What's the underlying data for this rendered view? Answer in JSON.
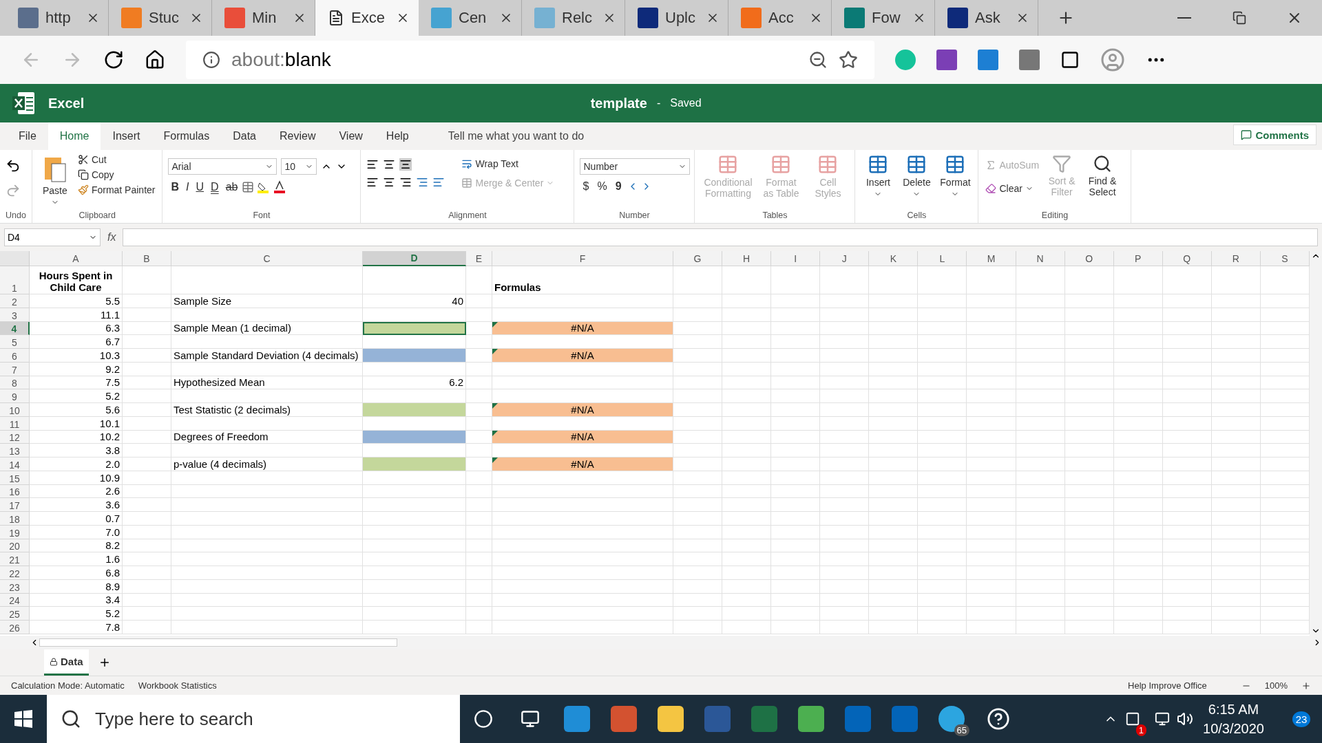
{
  "browser": {
    "tabs": [
      {
        "label": "http",
        "selected": false
      },
      {
        "label": "Stuc",
        "selected": false
      },
      {
        "label": "Min",
        "selected": false
      },
      {
        "label": "Exce",
        "selected": true
      },
      {
        "label": "Cen",
        "selected": false
      },
      {
        "label": "Relc",
        "selected": false
      },
      {
        "label": "Uplc",
        "selected": false
      },
      {
        "label": "Acc",
        "selected": false
      },
      {
        "label": "Fow",
        "selected": false
      },
      {
        "label": "Ask",
        "selected": false
      }
    ],
    "address": {
      "prefix": "about:",
      "value": "blank"
    }
  },
  "excel": {
    "app_name": "Excel",
    "document_title": "template",
    "separator": "-",
    "save_status": "Saved"
  },
  "ribbon": {
    "tabs": [
      {
        "label": "File",
        "selected": false
      },
      {
        "label": "Home",
        "selected": true
      },
      {
        "label": "Insert",
        "selected": false
      },
      {
        "label": "Formulas",
        "selected": false
      },
      {
        "label": "Data",
        "selected": false
      },
      {
        "label": "Review",
        "selected": false
      },
      {
        "label": "View",
        "selected": false
      },
      {
        "label": "Help",
        "selected": false
      }
    ],
    "tell_me": "Tell me what you want to do",
    "comments": "Comments",
    "groups": {
      "undo": {
        "label": "Undo"
      },
      "clipboard": {
        "label": "Clipboard",
        "paste": "Paste",
        "cut": "Cut",
        "copy": "Copy",
        "format_painter": "Format Painter"
      },
      "font": {
        "label": "Font",
        "font_name": "Arial",
        "font_size": "10",
        "bold": "B",
        "italic": "I",
        "underline": "U",
        "double_underline": "D",
        "strikethrough": "ab"
      },
      "alignment": {
        "label": "Alignment",
        "wrap_text": "Wrap Text",
        "merge_center": {
          "label": "Merge & Center",
          "disabled": true
        }
      },
      "number": {
        "label": "Number",
        "format": "Number",
        "currency": "$",
        "percent": "%",
        "comma": "9"
      },
      "tables": {
        "label": "Tables",
        "items": [
          {
            "label": "Conditional Formatting",
            "disabled": true
          },
          {
            "label": "Format as Table",
            "disabled": true
          },
          {
            "label": "Cell Styles",
            "disabled": true
          }
        ]
      },
      "cells": {
        "label": "Cells",
        "items": [
          {
            "label": "Insert",
            "disabled": false
          },
          {
            "label": "Delete",
            "disabled": false
          },
          {
            "label": "Format",
            "disabled": false
          }
        ]
      },
      "editing": {
        "label": "Editing",
        "autosum": {
          "label": "AutoSum",
          "disabled": true
        },
        "clear": {
          "label": "Clear",
          "disabled": false
        },
        "sort_filter": {
          "label": "Sort & Filter",
          "disabled": true
        },
        "find_select": {
          "label": "Find & Select",
          "disabled": false
        }
      }
    }
  },
  "formula_bar": {
    "name_box": "D4",
    "fx": "fx"
  },
  "sheet": {
    "columns": [
      {
        "label": "A",
        "selected": false
      },
      {
        "label": "B",
        "selected": false
      },
      {
        "label": "C",
        "selected": false
      },
      {
        "label": "D",
        "selected": true
      },
      {
        "label": "E",
        "selected": false
      },
      {
        "label": "F",
        "selected": false
      },
      {
        "label": "G",
        "selected": false
      },
      {
        "label": "H",
        "selected": false
      },
      {
        "label": "I",
        "selected": false
      },
      {
        "label": "J",
        "selected": false
      },
      {
        "label": "K",
        "selected": false
      },
      {
        "label": "L",
        "selected": false
      },
      {
        "label": "M",
        "selected": false
      },
      {
        "label": "N",
        "selected": false
      },
      {
        "label": "O",
        "selected": false
      },
      {
        "label": "P",
        "selected": false
      },
      {
        "label": "Q",
        "selected": false
      },
      {
        "label": "R",
        "selected": false
      },
      {
        "label": "S",
        "selected": false
      }
    ],
    "rows": [
      {
        "number": "1",
        "kind": "header",
        "selected": false,
        "a": "Hours Spent in Child Care",
        "f": {
          "text": "Formulas"
        }
      },
      {
        "number": "2",
        "kind": "data",
        "selected": false,
        "a": "5.5",
        "c": "Sample Size",
        "d": {
          "text": "40"
        }
      },
      {
        "number": "3",
        "kind": "data",
        "selected": false,
        "a": "11.1"
      },
      {
        "number": "4",
        "kind": "data",
        "selected": true,
        "a": "6.3",
        "c": "Sample Mean (1 decimal)",
        "d": {
          "color": "#c4d79b",
          "selected": true
        },
        "f": {
          "text": "#N/A",
          "color": "#f8be91",
          "flag": true
        }
      },
      {
        "number": "5",
        "kind": "data",
        "selected": false,
        "a": "6.7"
      },
      {
        "number": "6",
        "kind": "data",
        "selected": false,
        "a": "10.3",
        "c": "Sample Standard Deviation (4 decimals)",
        "d": {
          "color": "#95b3d7",
          "selected": false
        },
        "f": {
          "text": "#N/A",
          "color": "#f8be91",
          "flag": true
        }
      },
      {
        "number": "7",
        "kind": "data",
        "selected": false,
        "a": "9.2"
      },
      {
        "number": "8",
        "kind": "data",
        "selected": false,
        "a": "7.5",
        "c": "Hypothesized Mean",
        "d": {
          "text": "6.2"
        }
      },
      {
        "number": "9",
        "kind": "data",
        "selected": false,
        "a": "5.2"
      },
      {
        "number": "10",
        "kind": "data",
        "selected": false,
        "a": "5.6",
        "c": "Test Statistic (2 decimals)",
        "d": {
          "color": "#c4d79b",
          "selected": false
        },
        "f": {
          "text": "#N/A",
          "color": "#f8be91",
          "flag": true
        }
      },
      {
        "number": "11",
        "kind": "data",
        "selected": false,
        "a": "10.1"
      },
      {
        "number": "12",
        "kind": "data",
        "selected": false,
        "a": "10.2",
        "c": "Degrees of Freedom",
        "d": {
          "color": "#95b3d7",
          "selected": false
        },
        "f": {
          "text": "#N/A",
          "color": "#f8be91",
          "flag": true
        }
      },
      {
        "number": "13",
        "kind": "data",
        "selected": false,
        "a": "3.8"
      },
      {
        "number": "14",
        "kind": "data",
        "selected": false,
        "a": "2.0",
        "c": "p-value (4 decimals)",
        "d": {
          "color": "#c4d79b",
          "selected": false
        },
        "f": {
          "text": "#N/A",
          "color": "#f8be91",
          "flag": true
        }
      },
      {
        "number": "15",
        "kind": "data",
        "selected": false,
        "a": "10.9"
      },
      {
        "number": "16",
        "kind": "data",
        "selected": false,
        "a": "2.6"
      },
      {
        "number": "17",
        "kind": "data",
        "selected": false,
        "a": "3.6"
      },
      {
        "number": "18",
        "kind": "data",
        "selected": false,
        "a": "0.7"
      },
      {
        "number": "19",
        "kind": "data",
        "selected": false,
        "a": "7.0"
      },
      {
        "number": "20",
        "kind": "data",
        "selected": false,
        "a": "8.2"
      },
      {
        "number": "21",
        "kind": "data",
        "selected": false,
        "a": "1.6"
      },
      {
        "number": "22",
        "kind": "data",
        "selected": false,
        "a": "6.8"
      },
      {
        "number": "23",
        "kind": "data",
        "selected": false,
        "a": "8.9"
      },
      {
        "number": "24",
        "kind": "data",
        "selected": false,
        "a": "3.4"
      },
      {
        "number": "25",
        "kind": "data",
        "selected": false,
        "a": "5.2"
      },
      {
        "number": "26",
        "kind": "data",
        "selected": false,
        "a": "7.8"
      }
    ],
    "sheet_tabs": [
      {
        "label": "Data",
        "selected": true
      }
    ]
  },
  "status_bar": {
    "calculation": "Calculation Mode: Automatic",
    "statistics": "Workbook Statistics",
    "help": "Help Improve Office",
    "zoom": "100%"
  },
  "taskbar": {
    "search_placeholder": "Type here to search",
    "time": "6:15 AM",
    "date": "10/3/2020",
    "telegram_badge": "65",
    "dropbox_badge": "1",
    "notification_count": "23"
  }
}
